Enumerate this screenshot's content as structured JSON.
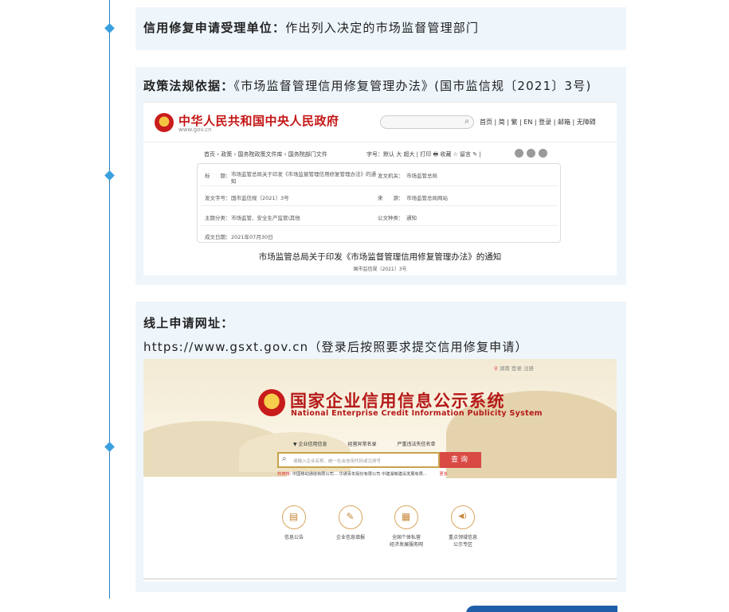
{
  "card1": {
    "label": "信用修复申请受理单位：",
    "value": "作出列入决定的市场监督管理部门"
  },
  "card2": {
    "label": "政策法规依据：",
    "value": "《市场监督管理信用修复管理办法》(国市监信规〔2021〕3号)",
    "screenshot": {
      "site_title": "中华人民共和国中央人民政府",
      "site_domain": "www.gov.cn",
      "search_icon": "search-icon",
      "nav": "首页 | 简 | 繁 | EN | 登录 | 邮箱 | 无障碍",
      "breadcrumb": "首页 › 政策 › 国务院政策文件库 › 国务院部门文件",
      "font_size": "字号：默认 大 超大    |    打印 🖶    收藏 ☆    留言 ✎    |",
      "rows": [
        {
          "k1": "标　　题：",
          "v1": "市场监管总局关于印发《市场监督管理信用修复管理办法》的通",
          "v1b": "知",
          "k2": "发文机关：",
          "v2": "市场监管总局"
        },
        {
          "k1": "发文字号：",
          "v1": "国市监信规〔2021〕3号",
          "k2": "来　　源：",
          "v2": "市场监管总局网站"
        },
        {
          "k1": "主题分类：",
          "v1": "市场监管、安全生产监管\\其他",
          "k2": "公文种类：",
          "v2": "通知"
        },
        {
          "k1": "成文日期：",
          "v1": "2021年07月30日"
        }
      ],
      "doc_title": "市场监管总局关于印发《市场监督管理信用修复管理办法》的通知",
      "doc_no": "国市监信规〔2021〕3号"
    }
  },
  "card3": {
    "label": "线上申请网址：",
    "value": " https://www.gsxt.gov.cn（登录后按照要求提交信用修复申请）",
    "screenshot": {
      "location": "湖南  登录  注册",
      "title": "国家企业信用信息公示系统",
      "subtitle": "National Enterprise Credit Information Publicity System",
      "tabs": [
        "▼ 企业信用信息",
        "经营异常名录",
        "严重违法失信名单"
      ],
      "search_placeholder": "请输入企业名称、统一社会信用代码或注册号",
      "search_button": "查询",
      "hot_label": "热搜榜:",
      "hot_items": "中国移动通信有限公司...     华通青年股份有限公司     中建湖南建设发展有限...",
      "hot_more": "更多",
      "tools": [
        {
          "icon": "notice-icon",
          "glyph": "▤",
          "label": "信息公告"
        },
        {
          "icon": "report-icon",
          "glyph": "✎",
          "label": "企业信息填报"
        },
        {
          "icon": "individual-icon",
          "glyph": "▦",
          "label": "全国个体私营\n经济发展服务网"
        },
        {
          "icon": "megaphone-icon",
          "glyph": "◀)",
          "label": "重点领域信息\n公示专区"
        }
      ]
    }
  }
}
